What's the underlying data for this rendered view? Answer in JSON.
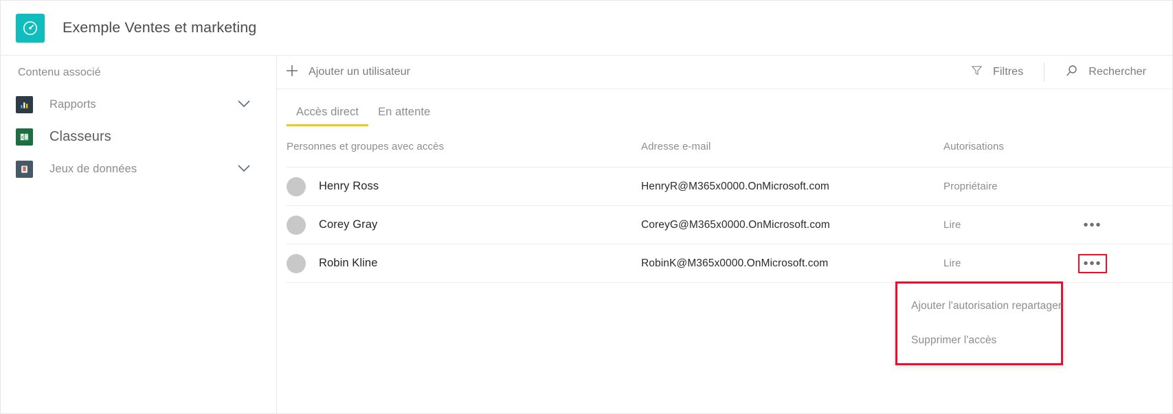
{
  "header": {
    "title": "Exemple Ventes et marketing",
    "app_icon": "dashboard-gauge-icon",
    "accent_color": "#0fbdbd"
  },
  "sidebar": {
    "heading": "Contenu associé",
    "items": [
      {
        "label": "Rapports",
        "icon": "bar-chart-icon",
        "icon_color": "#2d3b45",
        "expandable": true,
        "selected": false
      },
      {
        "label": "Classeurs",
        "icon": "excel-workbook-icon",
        "icon_color": "#1d6f42",
        "expandable": false,
        "selected": true
      },
      {
        "label": "Jeux de données",
        "icon": "dataset-icon",
        "icon_color": "#455a64",
        "expandable": true,
        "selected": false
      }
    ]
  },
  "toolbar": {
    "add_user_label": "Ajouter un utilisateur",
    "add_user_icon": "plus-icon",
    "filters_label": "Filtres",
    "filters_icon": "funnel-icon",
    "search_label": "Rechercher",
    "search_icon": "search-icon"
  },
  "tabs": [
    {
      "label": "Accès direct",
      "active": true
    },
    {
      "label": "En attente",
      "active": false
    }
  ],
  "tab_accent_color": "#f2c811",
  "table": {
    "columns": {
      "name": "Personnes et groupes avec accès",
      "email": "Adresse e-mail",
      "permissions": "Autorisations"
    },
    "rows": [
      {
        "name": "Henry Ross",
        "email": "HenryR@M365x0000.OnMicrosoft.com",
        "permission": "Propriétaire",
        "menu_visible": false,
        "menu_highlighted": false
      },
      {
        "name": "Corey Gray",
        "email": "CoreyG@M365x0000.OnMicrosoft.com",
        "permission": "Lire",
        "menu_visible": true,
        "menu_highlighted": false
      },
      {
        "name": "Robin Kline",
        "email": "RobinK@M365x0000.OnMicrosoft.com",
        "permission": "Lire",
        "menu_visible": true,
        "menu_highlighted": true
      }
    ],
    "ellipsis_glyph": "•••"
  },
  "context_menu": {
    "highlight_color": "#e8112d",
    "items": [
      {
        "label": "Ajouter l'autorisation repartager"
      },
      {
        "label": "Supprimer l'accès"
      }
    ]
  }
}
